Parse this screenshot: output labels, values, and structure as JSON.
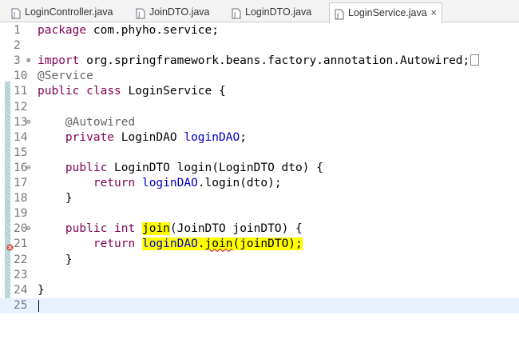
{
  "tabs": [
    {
      "label": "LoginController.java",
      "active": false
    },
    {
      "label": "JoinDTO.java",
      "active": false
    },
    {
      "label": "LoginDTO.java",
      "active": false
    },
    {
      "label": "LoginService.java",
      "active": true,
      "close": "×"
    }
  ],
  "lines": [
    {
      "n": "1",
      "t": [
        [
          "kw",
          "package"
        ],
        [
          "",
          " com.phyho.service;"
        ]
      ]
    },
    {
      "n": "2",
      "t": []
    },
    {
      "n": "3",
      "fold": "⊕",
      "t": [
        [
          "kw",
          "import"
        ],
        [
          "",
          " org.springframework.beans.factory.annotation.Autowired;"
        ]
      ],
      "collapsed": true
    },
    {
      "n": "10",
      "t": [
        [
          "ann",
          "@Service"
        ]
      ]
    },
    {
      "n": "11",
      "t": [
        [
          "kw",
          "public"
        ],
        [
          "",
          " "
        ],
        [
          "kw",
          "class"
        ],
        [
          "",
          " LoginService {"
        ]
      ]
    },
    {
      "n": "12",
      "t": []
    },
    {
      "n": "13",
      "fold": "⊖",
      "t": [
        [
          "",
          "    "
        ],
        [
          "ann",
          "@Autowired"
        ]
      ]
    },
    {
      "n": "14",
      "t": [
        [
          "",
          "    "
        ],
        [
          "kw",
          "private"
        ],
        [
          "",
          " LoginDAO "
        ],
        [
          "fld",
          "loginDAO"
        ],
        [
          "",
          ";"
        ]
      ]
    },
    {
      "n": "15",
      "t": []
    },
    {
      "n": "16",
      "fold": "⊖",
      "t": [
        [
          "",
          "    "
        ],
        [
          "kw",
          "public"
        ],
        [
          "",
          " LoginDTO login(LoginDTO dto) {"
        ]
      ]
    },
    {
      "n": "17",
      "t": [
        [
          "",
          "        "
        ],
        [
          "kw",
          "return"
        ],
        [
          "",
          " "
        ],
        [
          "fld",
          "loginDAO"
        ],
        [
          "",
          ".login(dto);"
        ]
      ]
    },
    {
      "n": "18",
      "t": [
        [
          "",
          "    }"
        ]
      ]
    },
    {
      "n": "19",
      "t": []
    },
    {
      "n": "20",
      "fold": "⊖",
      "t": [
        [
          "",
          "    "
        ],
        [
          "kw",
          "public"
        ],
        [
          "",
          " "
        ],
        [
          "kw",
          "int"
        ],
        [
          "",
          " "
        ],
        [
          "hl",
          "join"
        ],
        [
          "",
          "(JoinDTO joinDTO) {"
        ]
      ]
    },
    {
      "n": "21",
      "error": true,
      "t": [
        [
          "",
          "        "
        ],
        [
          "kw",
          "return"
        ],
        [
          "",
          " "
        ],
        [
          "hlfld",
          "loginDAO"
        ],
        [
          "hl",
          "."
        ],
        [
          "hlsq",
          "join"
        ],
        [
          "hl",
          "(joinDTO);"
        ]
      ]
    },
    {
      "n": "22",
      "t": [
        [
          "",
          "    }"
        ]
      ]
    },
    {
      "n": "23",
      "t": []
    },
    {
      "n": "24",
      "t": [
        [
          "",
          "}"
        ]
      ]
    },
    {
      "n": "25",
      "t": [],
      "current": true
    }
  ]
}
